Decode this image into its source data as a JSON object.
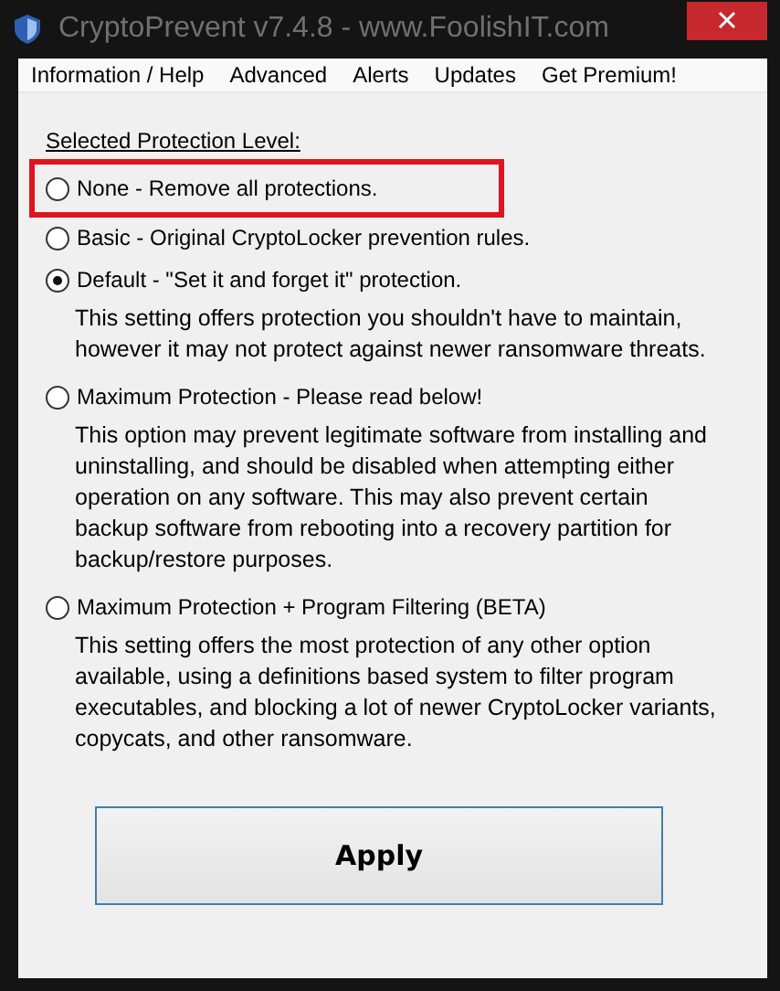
{
  "window": {
    "title": "CryptoPrevent v7.4.8 - www.FoolishIT.com"
  },
  "menu": [
    "Information / Help",
    "Advanced",
    "Alerts",
    "Updates",
    "Get Premium!"
  ],
  "group_label": "Selected Protection Level:",
  "options": [
    {
      "label": "None - Remove all protections.",
      "selected": false,
      "highlighted": true
    },
    {
      "label": "Basic - Original CryptoLocker prevention rules.",
      "selected": false,
      "highlighted": false
    },
    {
      "label": "Default - \"Set it and forget it\" protection.",
      "selected": true,
      "highlighted": false,
      "description": "This setting offers protection you shouldn't have to maintain, however it may not protect against newer ransomware threats."
    },
    {
      "label": "Maximum Protection - Please read below!",
      "selected": false,
      "highlighted": false,
      "description": "This option may prevent legitimate software from installing and uninstalling, and should be disabled when attempting either operation on any software.  This may also prevent certain backup software from rebooting into a recovery partition for backup/restore purposes."
    },
    {
      "label": "Maximum Protection + Program Filtering (BETA)",
      "selected": false,
      "highlighted": false,
      "description": "This setting offers the most protection of any other option available, using a definitions based system to filter program executables, and blocking a lot of newer CryptoLocker variants, copycats, and other ransomware."
    }
  ],
  "apply_button": "Apply"
}
